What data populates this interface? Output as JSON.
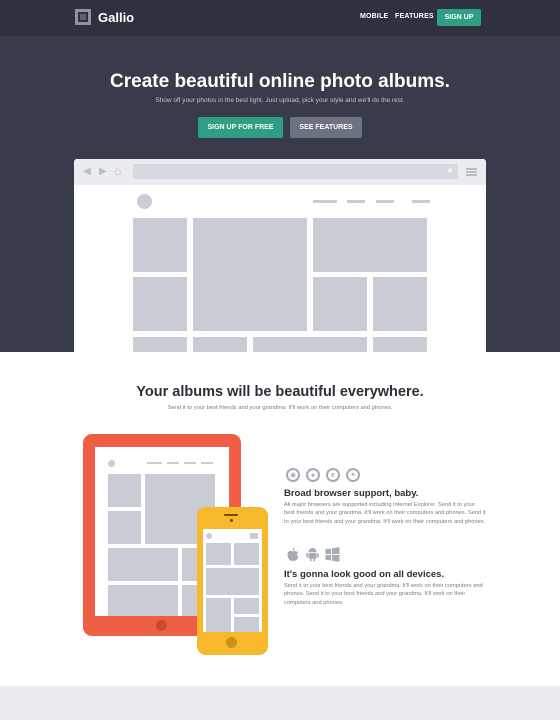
{
  "brand": {
    "name": "Gallio"
  },
  "nav": {
    "mobile": "MOBILE",
    "features": "FEATURES",
    "signup": "SIGN UP"
  },
  "hero": {
    "title": "Create beautiful online photo albums.",
    "subtitle": "Show off your photos in the best light.  Just upload, pick your style and we'll do the rest.",
    "primary_button": "SIGN UP FOR FREE",
    "secondary_button": "SEE FEATURES"
  },
  "section": {
    "title": "Your albums will be beautiful everywhere.",
    "subtitle": "Send it to your best friends and your grandma. It'll work on their computers and phones."
  },
  "features": [
    {
      "title": "Broad browser support, baby.",
      "text": "All major browsers are supported including Internet Explorer. Send it to your best friends and your grandma. It'll work on their computers and phones. Send it to your best friends and your grandma. It'll work on their computers and phones.",
      "icons": [
        "chrome-icon",
        "firefox-icon",
        "internet-explorer-icon",
        "safari-icon"
      ]
    },
    {
      "title": "It's gonna look good on all devices.",
      "text": "Send it to your best friends and your grandma. It'll work on their computers and phones. Send it to your best friends and your grandma. It'll work on their computers and phones.",
      "icons": [
        "apple-icon",
        "android-icon",
        "windows-icon"
      ]
    }
  ],
  "colors": {
    "hero_background": "#383c4a",
    "navbar_background": "#2f323e",
    "accent_green": "#2f9e83",
    "button_grey": "#6c7280",
    "tablet": "#ef5f45",
    "phone": "#f7b82b",
    "placeholder": "#c9ccd4"
  }
}
